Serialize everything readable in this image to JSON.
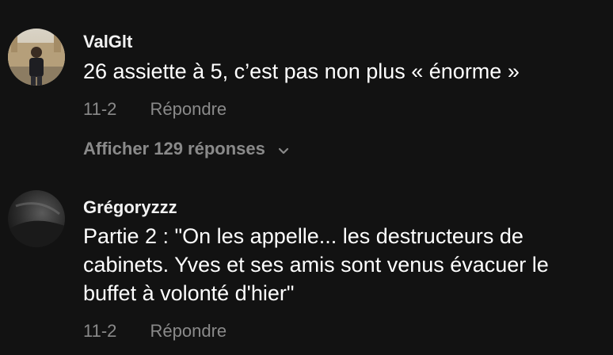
{
  "comments": [
    {
      "username": "ValGlt",
      "text": "26 assiette à 5, c’est pas non plus « énorme »",
      "date": "11-2",
      "reply_label": "Répondre",
      "view_replies_label": "Afficher 129 réponses",
      "avatar_icon": "avatar-photo-person"
    },
    {
      "username": "Grégoryzzz",
      "text": "Partie 2 : \"On les appelle... les destructeurs de cabinets. Yves et ses amis sont venus évacuer le buffet à volonté d'hier\"",
      "date": "11-2",
      "reply_label": "Répondre",
      "avatar_icon": "avatar-photo-dark"
    }
  ],
  "colors": {
    "background": "#121212",
    "primary_text": "#ffffff",
    "secondary_text": "#8a8a8a"
  }
}
